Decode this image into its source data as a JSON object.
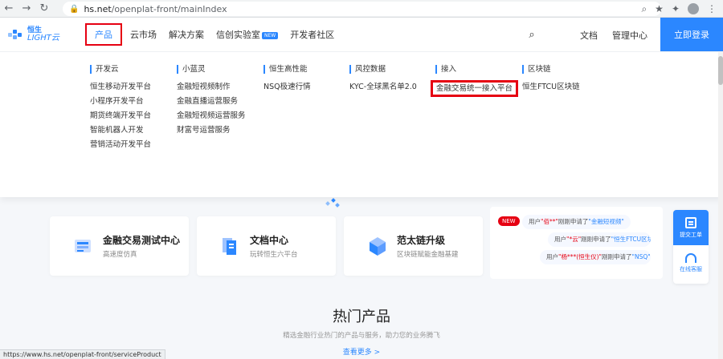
{
  "browser": {
    "url_host": "hs.net",
    "url_path": "/openplat-front/mainIndex",
    "status_url": "https://www.hs.net/openplat-front/serviceProduct"
  },
  "header": {
    "logo_top": "恒生",
    "logo_bottom": "LIGHT云",
    "nav": [
      {
        "label": "产品"
      },
      {
        "label": "云市场"
      },
      {
        "label": "解决方案"
      },
      {
        "label": "信创实验室"
      },
      {
        "label": "开发者社区"
      }
    ],
    "new_badge": "NEW",
    "docs_link": "文档",
    "admin_link": "管理中心",
    "login_button": "立即登录"
  },
  "dropdown": {
    "columns": [
      {
        "title": "开发云",
        "items": [
          "恒生移动开发平台",
          "小程序开发平台",
          "期货终端开发平台",
          "智能机器人开发",
          "营销活动开发平台"
        ]
      },
      {
        "title": "小蓝灵",
        "items": [
          "金融短视频制作",
          "金融直播运营服务",
          "金融短视频运营服务",
          "财富号运营服务"
        ]
      },
      {
        "title": "恒生高性能",
        "items": [
          "NSQ极速行情"
        ]
      },
      {
        "title": "风控数据",
        "items": [
          "KYC-全球黑名单2.0"
        ]
      },
      {
        "title": "接入",
        "items": [
          "金融交易统一接入平台"
        ]
      },
      {
        "title": "区块链",
        "items": [
          "恒生FTCU区块链"
        ]
      }
    ]
  },
  "cards": [
    {
      "title": "金融交易测试中心",
      "sub": "高速度仿真"
    },
    {
      "title": "文档中心",
      "sub": "玩转恒生六平台"
    },
    {
      "title": "范太链升级",
      "sub": "区块链赋能金融基建"
    }
  ],
  "news": {
    "badge": "NEW",
    "items": [
      {
        "pre": "用户",
        "hl": "\"佰**\"",
        "post": "刚刚申请了",
        "lnk": "\"金融短视频\""
      },
      {
        "pre": "用户",
        "hl": "\"*云\"",
        "post": "刚刚申请了",
        "lnk": "\"恒生FTCU区块链\""
      },
      {
        "pre": "用户",
        "hl": "\"杨***(恒生仪)\"",
        "post": "刚刚申请了",
        "lnk": "\"NSQ\""
      }
    ]
  },
  "side": {
    "ticket": "提交工单",
    "consult": "在线客服"
  },
  "section": {
    "title": "热门产品",
    "subtitle": "精选金融行业热门的产品与服务，助力您的业务腾飞",
    "more": "查看更多 >"
  }
}
